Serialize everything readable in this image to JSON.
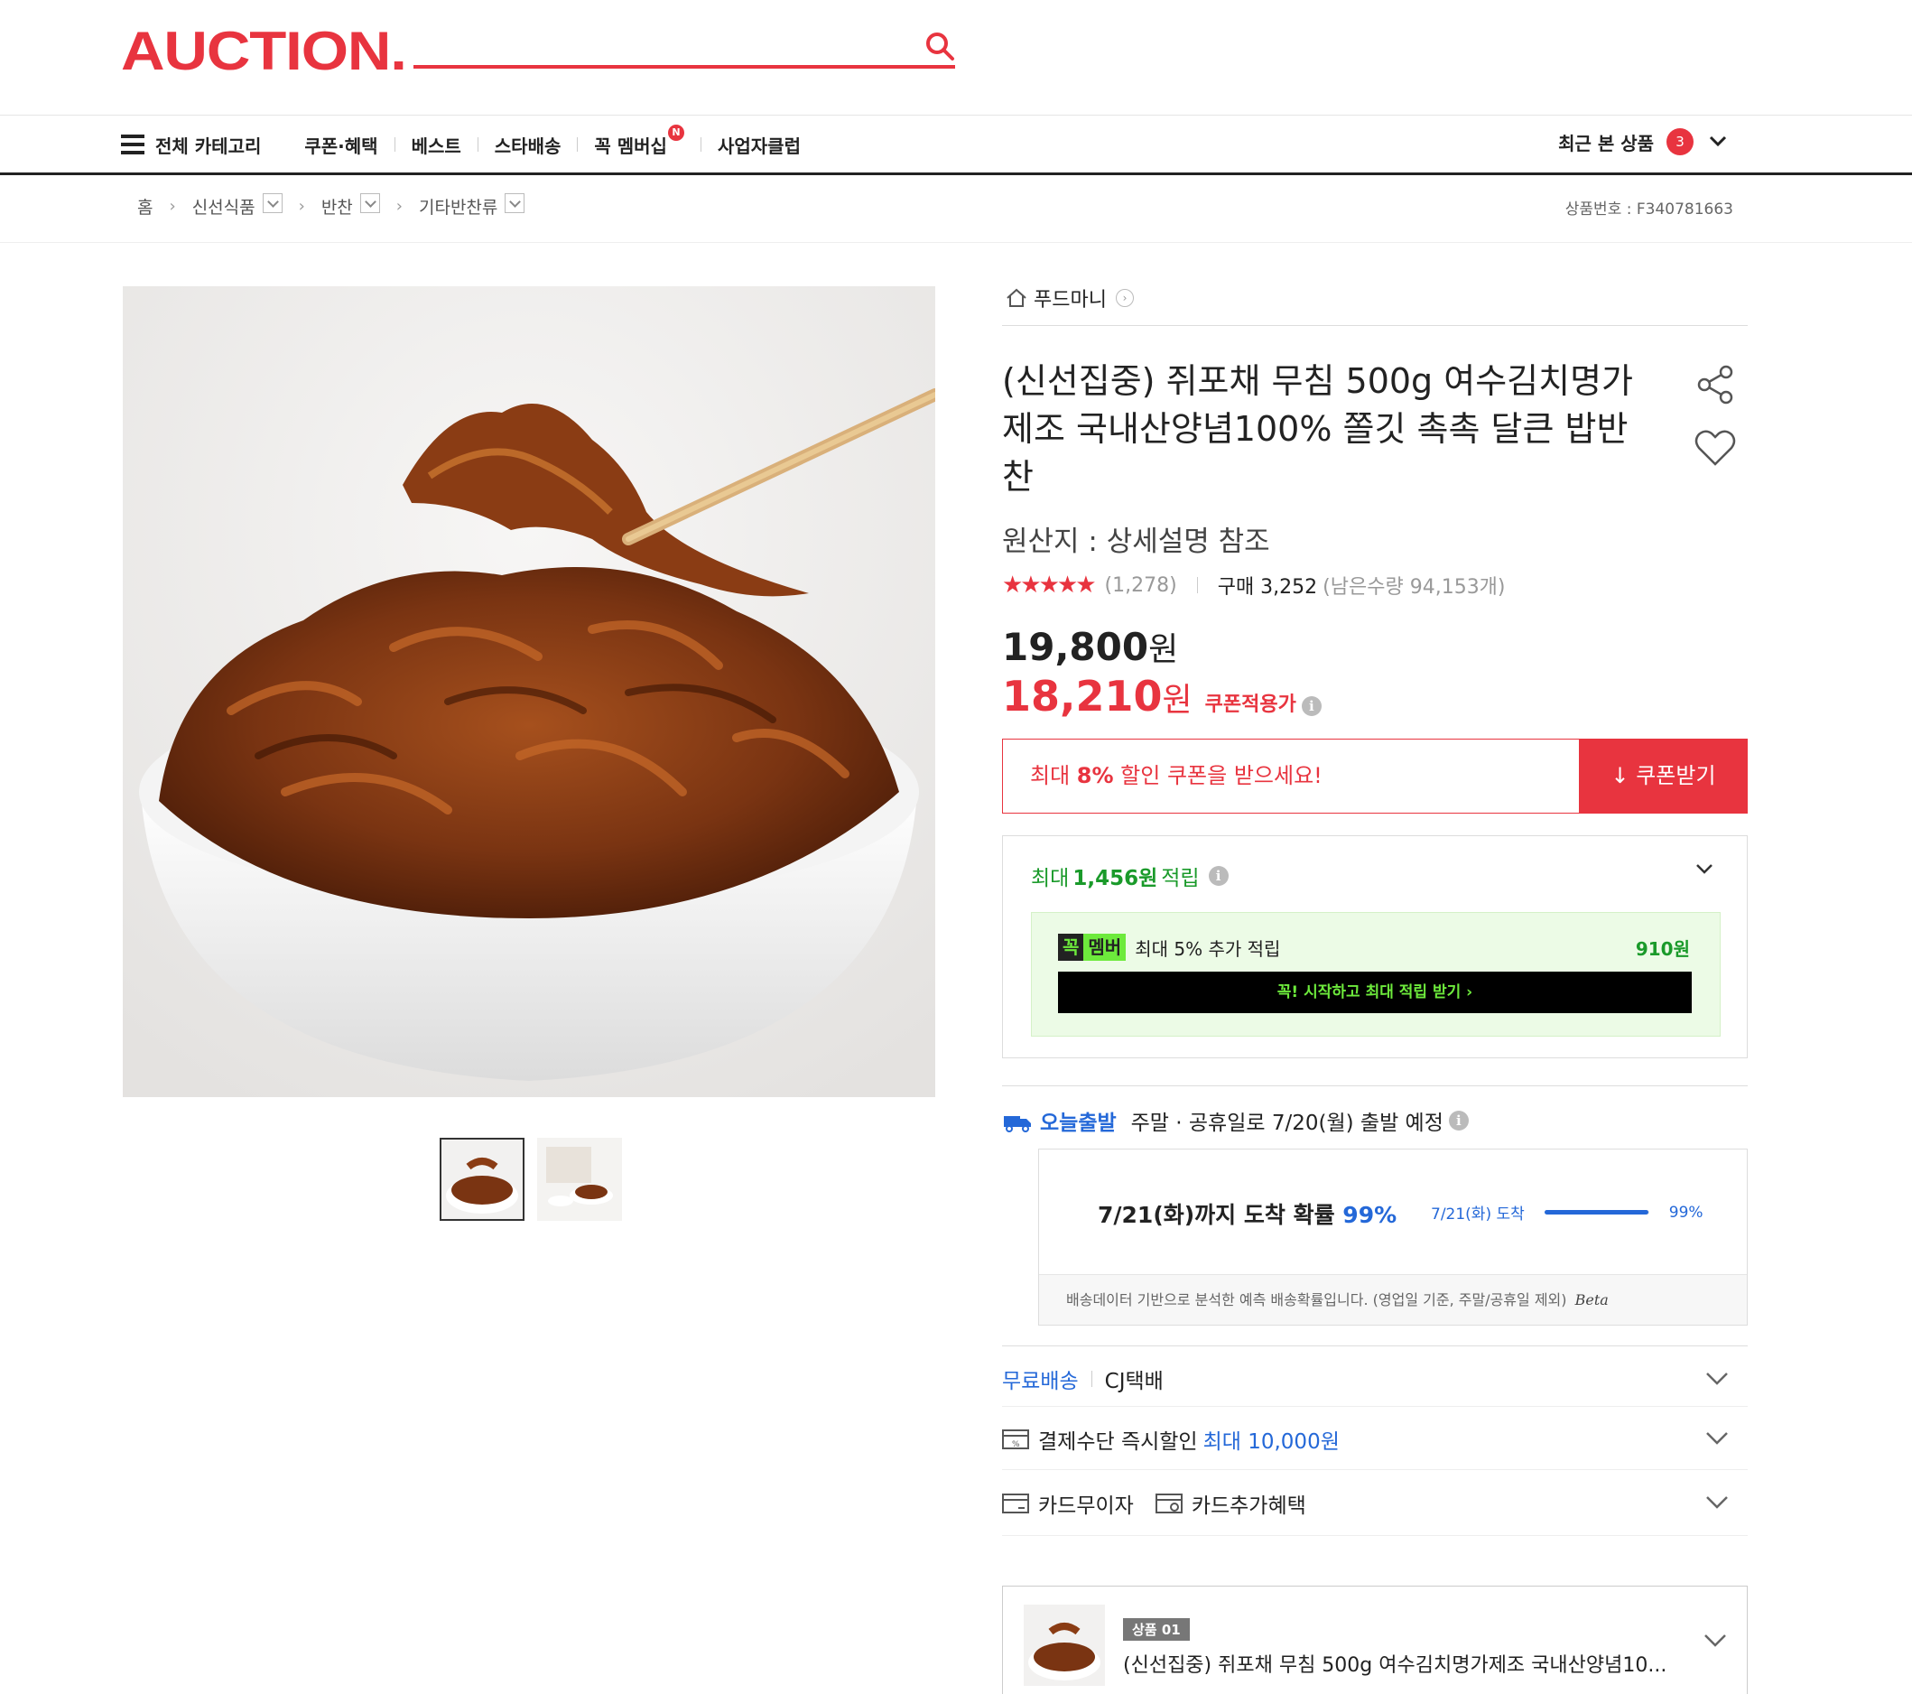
{
  "header": {
    "logo": "AUCTION.",
    "nav": {
      "all_category": "전체 카테고리",
      "items": [
        "쿠폰·혜택",
        "베스트",
        "스타배송",
        "꼭 멤버십",
        "사업자클럽"
      ],
      "membership_badge": "N"
    },
    "recent": {
      "label": "최근 본 상품",
      "count": "3"
    }
  },
  "breadcrumb": {
    "home": "홈",
    "levels": [
      "신선식품",
      "반찬",
      "기타반찬류"
    ],
    "product_number": "상품번호 : F340781663"
  },
  "product": {
    "seller": "푸드마니",
    "title": "(신선집중) 쥐포채 무침 500g 여수김치명가제조 국내산양념100% 쫄깃 촉촉 달큰 밥반찬",
    "origin": "원산지 : 상세설명 참조",
    "rating_stars": 4.5,
    "review_count": "(1,278)",
    "purchase": "구매 3,252",
    "remaining": "(남은수량 94,153개)",
    "price_original": "19,800",
    "price_sale": "18,210",
    "won": "원",
    "sale_label": "쿠폰적용가",
    "info_glyph": "i",
    "coupon": {
      "text_prefix": "최대 ",
      "text_pct": "8%",
      "text_suffix": " 할인 쿠폰을 받으세요!",
      "button": "↓ 쿠폰받기"
    },
    "points": {
      "prefix": "최대",
      "amount": "1,456원",
      "suffix": "적립",
      "member_k": "꼭",
      "member_m": "멤버",
      "member_text": "최대 5% 추가 적립",
      "member_amount": "910원",
      "member_cta": "꼭! 시작하고 최대 적립 받기 ›"
    },
    "shipping": {
      "today_label": "오늘출발",
      "today_text": "주말 · 공휴일로 7/20(월) 출발 예정",
      "prob_prefix": "7/21(화)까지 도착 확률",
      "prob_pct": "99%",
      "mini_label": "7/21(화) 도착",
      "mini_pct": "99%",
      "prob_fraction": 0.99,
      "note": "배송데이터 기반으로 분석한 예측 배송확률입니다. (영업일 기준, 주말/공휴일 제외)",
      "beta": "Beta",
      "free": "무료배송",
      "carrier": "CJ택배"
    },
    "payment": {
      "label": "결제수단 즉시할인",
      "highlight": "최대 10,000원",
      "installment": "카드무이자",
      "card_benefit": "카드추가혜택"
    },
    "option": {
      "tag": "상품 01",
      "name": "(신선집중) 쥐포채 무침 500g 여수김치명가제조 국내산양념10..."
    }
  },
  "colors": {
    "brand": "#e8343f",
    "green": "#1a9a2a",
    "blue": "#2468d8",
    "member_green": "#6dea3c"
  }
}
